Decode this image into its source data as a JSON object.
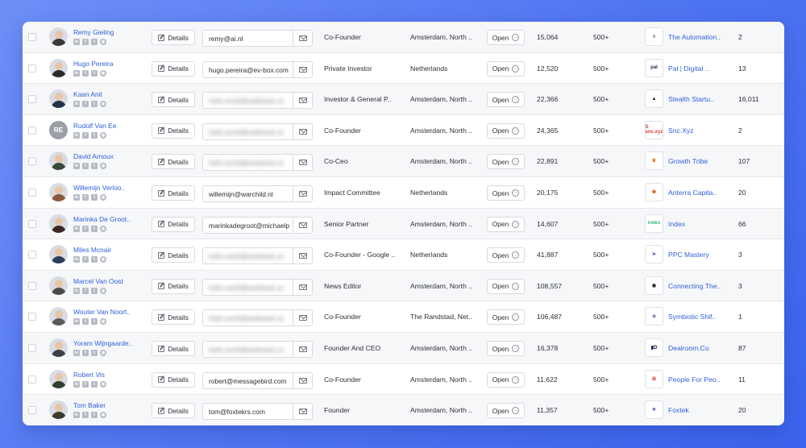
{
  "labels": {
    "details": "Details",
    "open": "Open",
    "open_arrow": "→"
  },
  "rows": [
    {
      "name": "Remy Gieling",
      "email": "remy@ai.nl",
      "email_hidden": false,
      "title": "Co-Founder",
      "location": "Amsterdam, North ..",
      "followers": "15,064",
      "connections": "500+",
      "company": "The Automation..",
      "company_logo": "lines-logo-icon",
      "logo_text": "≡",
      "logo_color": "#111111",
      "count": "2",
      "initials": "",
      "avatar_color": "#3a3a3a"
    },
    {
      "name": "Hugo Pereira",
      "email": "hugo.pereira@ev-box.com",
      "email_hidden": false,
      "title": "Private Investor",
      "location": "Netherlands",
      "followers": "12,520",
      "connections": "500+",
      "company": "Pal | Digital ..",
      "company_logo": "pal-logo-icon",
      "logo_text": "pal",
      "logo_color": "#1c2340",
      "count": "13",
      "initials": "",
      "avatar_color": "#2b2b2b"
    },
    {
      "name": "Kaan Anit",
      "email": "hello.world@webtastic.ai",
      "email_hidden": true,
      "title": "Investor & General P..",
      "location": "Amsterdam, North ..",
      "followers": "22,366",
      "connections": "500+",
      "company": "Stealth Startu..",
      "company_logo": "stealth-logo-icon",
      "logo_text": "▲",
      "logo_color": "#1f1f1f",
      "count": "16,011",
      "initials": "",
      "avatar_color": "#24324a"
    },
    {
      "name": "Rudolf Van Ee",
      "email": "hello.world@webtastic.ai",
      "email_hidden": true,
      "title": "Co-Founder",
      "location": "Amsterdam, North ..",
      "followers": "24,365",
      "connections": "500+",
      "company": "Snc.Xyz",
      "company_logo": "snc-logo-icon",
      "logo_text": "S snc.xyz",
      "logo_color": "#d43a2f",
      "count": "2",
      "initials": "RE",
      "avatar_color": "#9aa0a8"
    },
    {
      "name": "David Arnoux",
      "email": "hello.world@webtastic.ai",
      "email_hidden": true,
      "title": "Co-Ceo",
      "location": "Amsterdam, North ..",
      "followers": "22,891",
      "connections": "500+",
      "company": "Growth Tribe",
      "company_logo": "growth-tribe-logo-icon",
      "logo_text": "♛",
      "logo_color": "#e8731c",
      "count": "107",
      "initials": "",
      "avatar_color": "#3a4a3a"
    },
    {
      "name": "Willemijn Verloo..",
      "email": "willemijn@warchild.nl",
      "email_hidden": false,
      "title": "Impact Committee",
      "location": "Netherlands",
      "followers": "20,175",
      "connections": "500+",
      "company": "Anterra Capita..",
      "company_logo": "anterra-logo-icon",
      "logo_text": "✺",
      "logo_color": "#e4632a",
      "count": "20",
      "initials": "",
      "avatar_color": "#8a5a3c"
    },
    {
      "name": "Marinka De Groot..",
      "email": "marinkadegroot@michaelpage.nl",
      "email_hidden": false,
      "title": "Senior Partner",
      "location": "Amsterdam, North ..",
      "followers": "14,607",
      "connections": "500+",
      "company": "Index",
      "company_logo": "index-logo-icon",
      "logo_text": "index",
      "logo_color": "#3cb77a",
      "count": "66",
      "initials": "",
      "avatar_color": "#3b2a24"
    },
    {
      "name": "Miles Mcnair",
      "email": "hello.world@webtastic.ai",
      "email_hidden": true,
      "title": "Co-Founder - Google ..",
      "location": "Netherlands",
      "followers": "41,887",
      "connections": "500+",
      "company": "PPC Mastery",
      "company_logo": "ppc-mastery-logo-icon",
      "logo_text": "➤",
      "logo_color": "#3f5fb5",
      "count": "3",
      "initials": "",
      "avatar_color": "#2c3b5a"
    },
    {
      "name": "Marcel Van Oost",
      "email": "hello.world@webtastic.ai",
      "email_hidden": true,
      "title": "News Editor",
      "location": "Amsterdam, North ..",
      "followers": "108,557",
      "connections": "500+",
      "company": "Connecting The..",
      "company_logo": "connecting-logo-icon",
      "logo_text": "◉",
      "logo_color": "#222222",
      "count": "3",
      "initials": "",
      "avatar_color": "#4a4a4a"
    },
    {
      "name": "Wouter Van Noort..",
      "email": "hello.world@webtastic.ai",
      "email_hidden": true,
      "title": "Co-Founder",
      "location": "The Randstad, Net..",
      "followers": "106,487",
      "connections": "500+",
      "company": "Symbiotic Shif..",
      "company_logo": "symbiotic-logo-icon",
      "logo_text": "◈",
      "logo_color": "#6e7fa8",
      "count": "1",
      "initials": "",
      "avatar_color": "#5a5a5a"
    },
    {
      "name": "Yoram Wijngaarde..",
      "email": "hello.world@webtastic.ai",
      "email_hidden": true,
      "title": "Founder And CEO",
      "location": "Amsterdam, North ..",
      "followers": "16,378",
      "connections": "500+",
      "company": "Dealroom.Co",
      "company_logo": "dealroom-logo-icon",
      "logo_text": "▮D",
      "logo_color": "#0f1b3d",
      "count": "87",
      "initials": "",
      "avatar_color": "#3a3f48"
    },
    {
      "name": "Robert Vis",
      "email": "robert@messagebird.com",
      "email_hidden": false,
      "title": "Co-Founder",
      "location": "Amsterdam, North ..",
      "followers": "11,622",
      "connections": "500+",
      "company": "People For Peo..",
      "company_logo": "people-for-people-logo-icon",
      "logo_text": "☮",
      "logo_color": "#d62a2a",
      "count": "11",
      "initials": "",
      "avatar_color": "#2f3f2f"
    },
    {
      "name": "Tom Baker",
      "email": "tom@foxtekrs.com",
      "email_hidden": false,
      "title": "Founder",
      "location": "Amsterdam, North ..",
      "followers": "11,357",
      "connections": "500+",
      "company": "Foxtek",
      "company_logo": "foxtek-logo-icon",
      "logo_text": "✈",
      "logo_color": "#1d3f9a",
      "count": "20",
      "initials": "",
      "avatar_color": "#3a3a2a"
    }
  ],
  "socials": [
    {
      "icon": "linkedin-icon",
      "glyph": "in"
    },
    {
      "icon": "facebook-icon",
      "glyph": "f"
    },
    {
      "icon": "twitter-icon",
      "glyph": "t"
    },
    {
      "icon": "github-icon",
      "glyph": "◉"
    }
  ]
}
